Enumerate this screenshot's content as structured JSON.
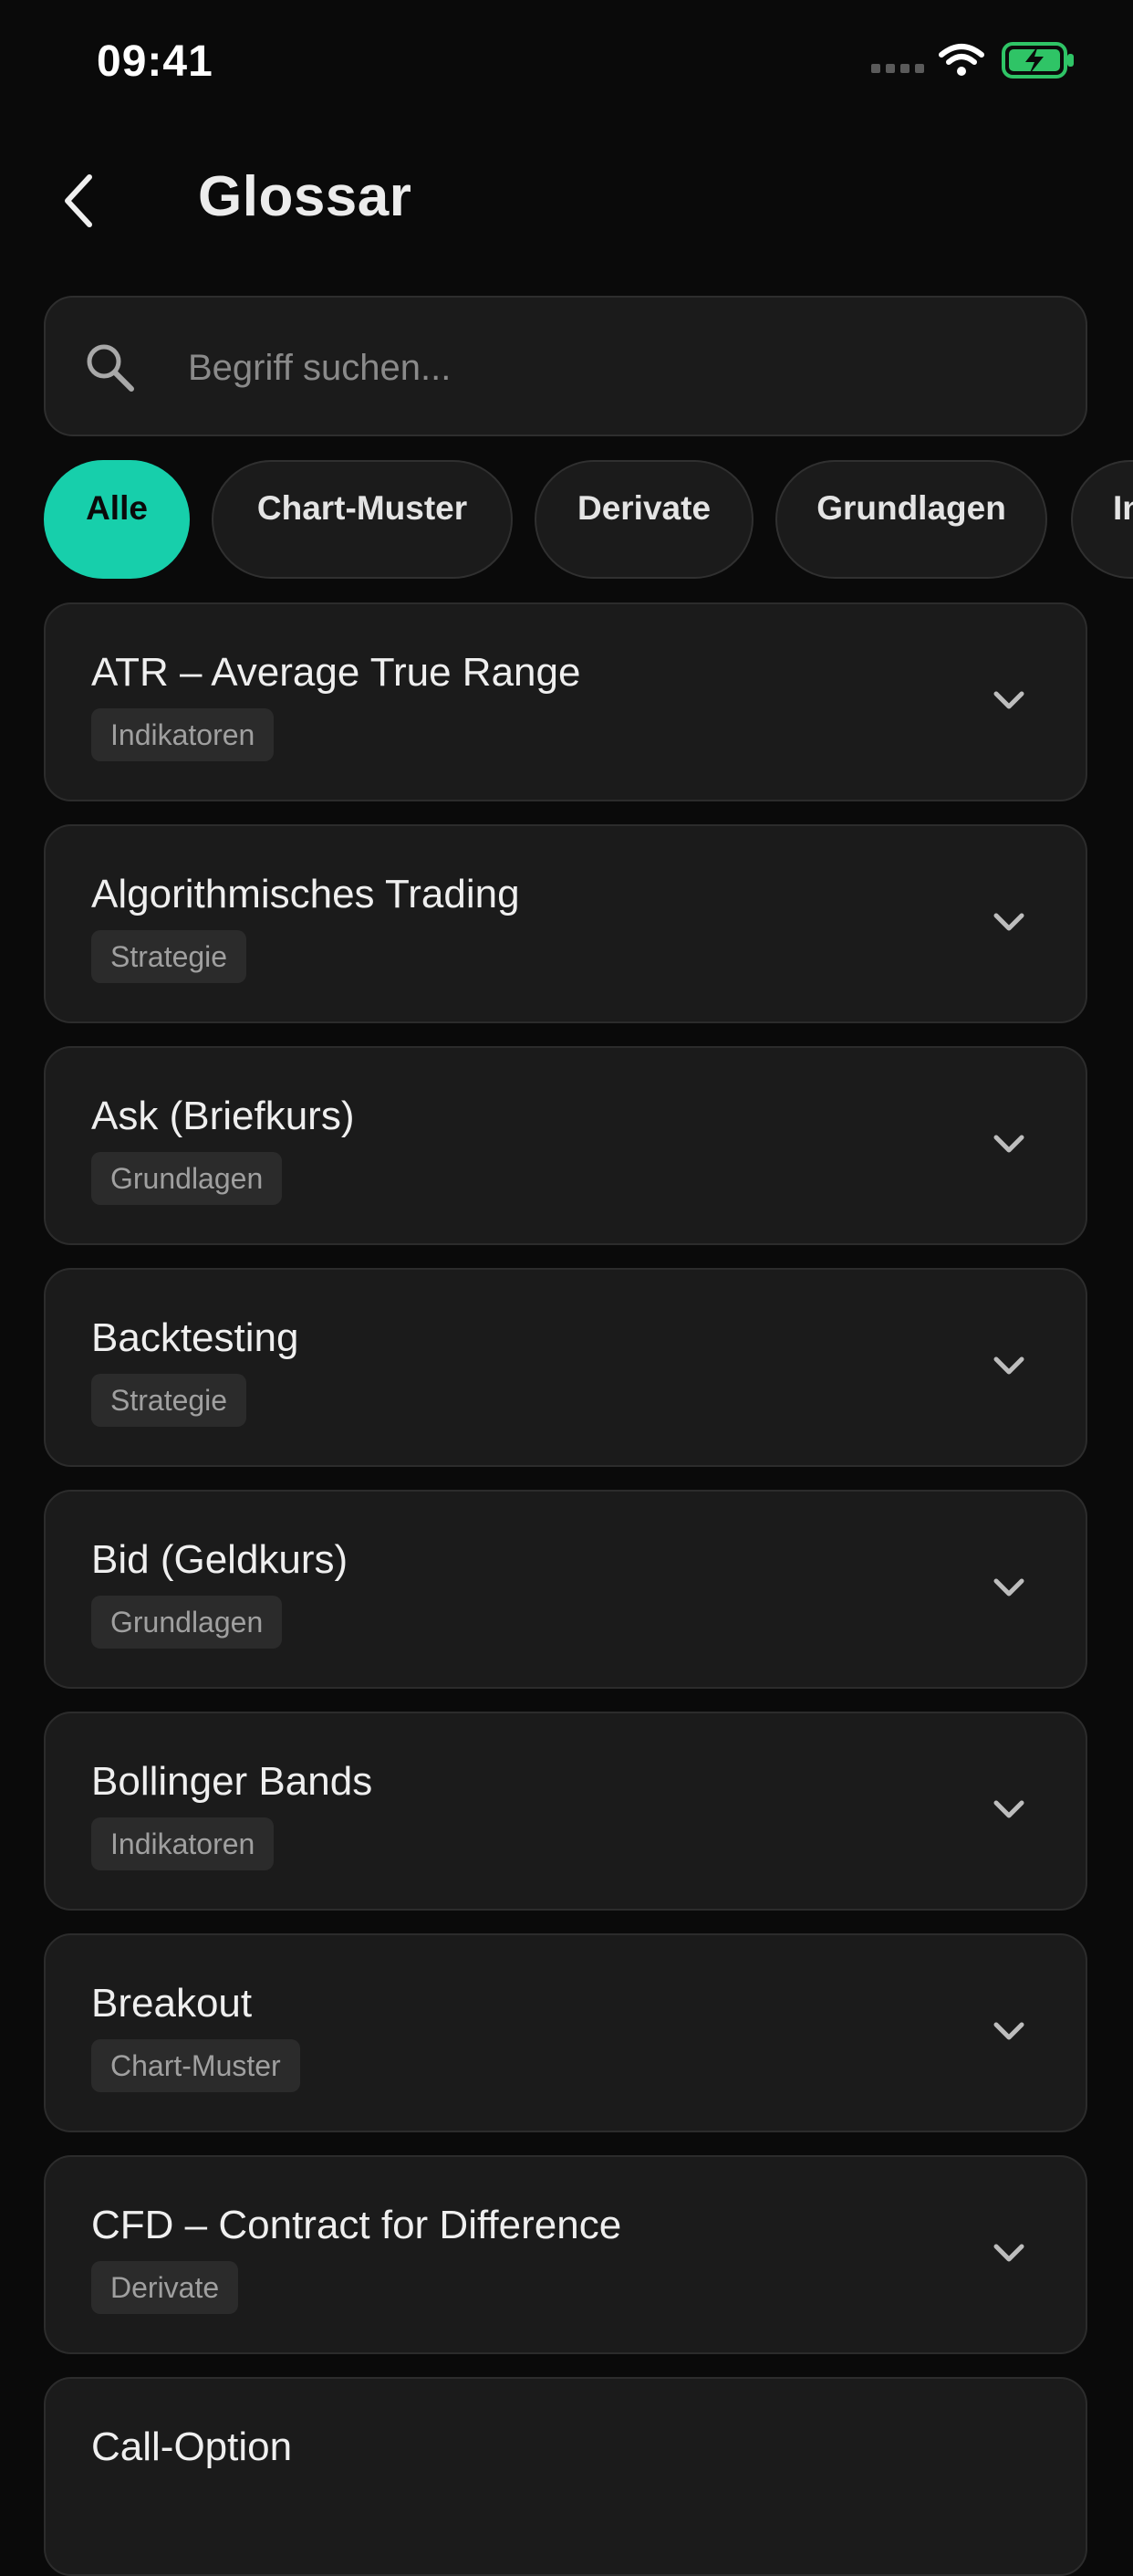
{
  "status": {
    "time": "09:41"
  },
  "header": {
    "title": "Glossar"
  },
  "search": {
    "placeholder": "Begriff suchen..."
  },
  "filters": [
    "Alle",
    "Chart-Muster",
    "Derivate",
    "Grundlagen",
    "In"
  ],
  "active_filter": "Alle",
  "accent_color": "#17cfab",
  "icons": [
    "chevron-left-icon",
    "search-icon",
    "chevron-down-icon",
    "wifi-icon",
    "battery-charging-icon"
  ],
  "terms": [
    {
      "title": "ATR – Average True Range",
      "category": "Indikatoren"
    },
    {
      "title": "Algorithmisches Trading",
      "category": "Strategie"
    },
    {
      "title": "Ask (Briefkurs)",
      "category": "Grundlagen"
    },
    {
      "title": "Backtesting",
      "category": "Strategie"
    },
    {
      "title": "Bid (Geldkurs)",
      "category": "Grundlagen"
    },
    {
      "title": "Bollinger Bands",
      "category": "Indikatoren"
    },
    {
      "title": "Breakout",
      "category": "Chart-Muster"
    },
    {
      "title": "CFD – Contract for Difference",
      "category": "Derivate"
    },
    {
      "title": "Call-Option",
      "category": ""
    }
  ]
}
